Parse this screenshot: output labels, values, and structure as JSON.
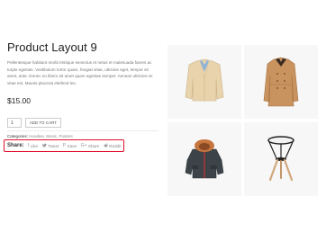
{
  "product": {
    "title": "Product Layout 9",
    "description": "Pellentesque habitant morbi tristique senectus et netus et malesuada fames ac turpis egestas. Vestibulum tortor quam, feugiat vitae, ultricies eget, tempor sit amet, ante. Donec eu libero sit amet quam egestas semper. Aenean ultricies mi vitae est. Mauris placerat eleifend leo.",
    "price": "$15.00",
    "quantity": "1",
    "add_to_cart_label": "ADD TO CART",
    "categories_label": "Categories:",
    "categories_value": "Hoodies, Music, Posters"
  },
  "share": {
    "label": "Share:",
    "items": [
      {
        "label": "Like",
        "icon": "facebook-icon"
      },
      {
        "label": "Tweet",
        "icon": "twitter-icon"
      },
      {
        "label": "Save",
        "icon": "pinterest-icon"
      },
      {
        "label": "Share",
        "icon": "google-plus-icon"
      },
      {
        "label": "Reddit",
        "icon": "reddit-icon"
      }
    ],
    "highlight_color": "#e0102b"
  },
  "gallery": [
    "blazer-image",
    "camel-coat-image",
    "winter-parka-image",
    "side-table-image"
  ]
}
